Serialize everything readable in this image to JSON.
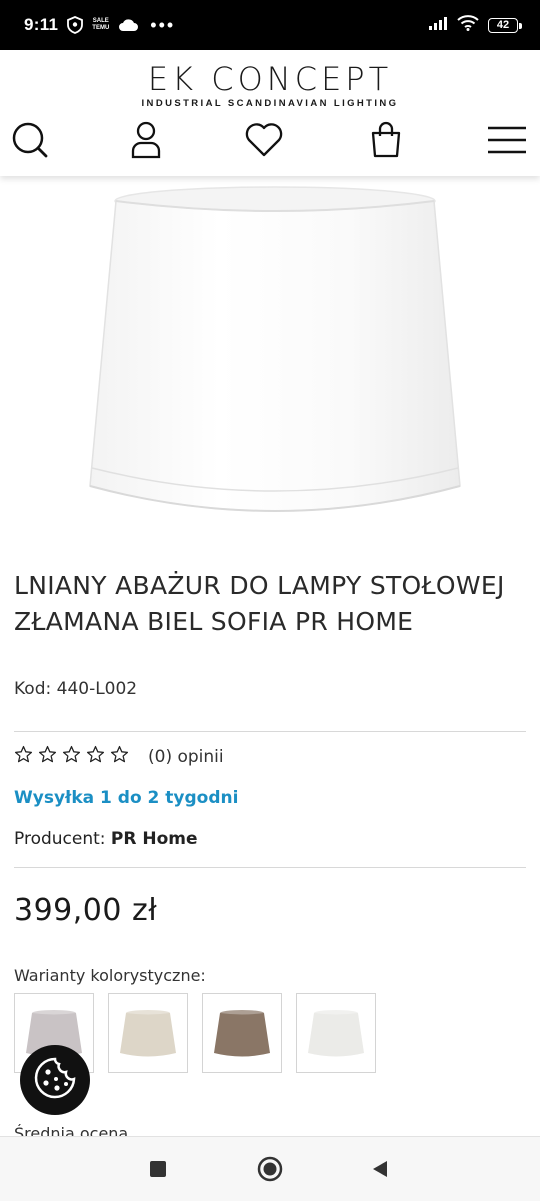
{
  "status_bar": {
    "time": "9:11",
    "temu_label_top": "SALE",
    "temu_label_bottom": "TEMU",
    "more": "•••",
    "battery": "42",
    "icons": [
      "shield-icon",
      "temu-icon",
      "cloud-icon",
      "signal-icon",
      "wifi-icon",
      "battery-icon"
    ]
  },
  "header": {
    "brand": "EK CONCEPT",
    "tagline": "INDUSTRIAL SCANDINAVIAN LIGHTING",
    "icons": [
      "search-icon",
      "user-icon",
      "heart-icon",
      "shopping-bag-icon",
      "menu-icon"
    ]
  },
  "product": {
    "title": "LNIANY ABAŻUR DO LAMPY STOŁOWEJ ZŁAMANA BIEL SOFIA PR HOME",
    "code": "Kod: 440-L002",
    "rating_text": "(0) opinii",
    "rating": 0,
    "rating_max": 5,
    "shipping": "Wysyłka 1 do 2 tygodni",
    "producer_label": "Producent: ",
    "producer_name": "PR Home",
    "price": "399,00 zł",
    "variants_label": "Warianty kolorystyczne:",
    "variant_colors": [
      "#c9c3c5",
      "#ddd6c8",
      "#8a7666",
      "#ebebe8"
    ],
    "next_section_peek": "Średnia ocena"
  },
  "colors": {
    "accent": "#1b8fc4",
    "status_bar": "#000000",
    "text": "#222222"
  },
  "nav_bar": {
    "icons": [
      "recents-square-icon",
      "home-circle-icon",
      "back-triangle-icon"
    ]
  }
}
